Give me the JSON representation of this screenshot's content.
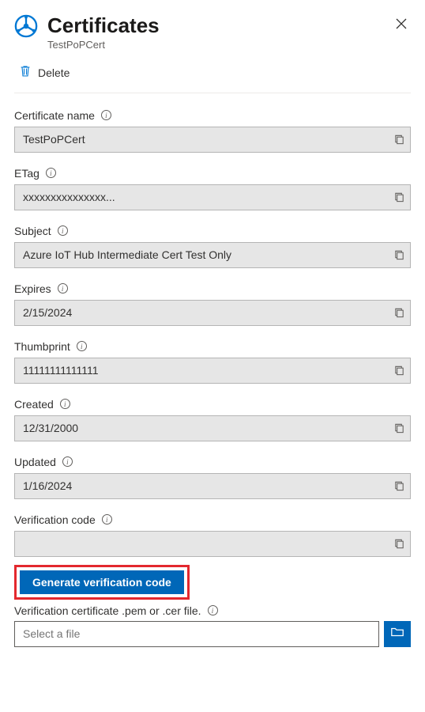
{
  "header": {
    "title": "Certificates",
    "subtitle": "TestPoPCert"
  },
  "toolbar": {
    "delete_label": "Delete"
  },
  "fields": {
    "certificate_name": {
      "label": "Certificate name",
      "value": "TestPoPCert"
    },
    "etag": {
      "label": "ETag",
      "value": "xxxxxxxxxxxxxxx..."
    },
    "subject": {
      "label": "Subject",
      "value": "Azure IoT Hub Intermediate Cert Test Only"
    },
    "expires": {
      "label": "Expires",
      "value": "2/15/2024"
    },
    "thumbprint": {
      "label": "Thumbprint",
      "value": "11111111111111"
    },
    "created": {
      "label": "Created",
      "value": "12/31/2000"
    },
    "updated": {
      "label": "Updated",
      "value": "1/16/2024"
    },
    "verification_code": {
      "label": "Verification code",
      "value": ""
    }
  },
  "actions": {
    "generate_label": "Generate verification code"
  },
  "file": {
    "label": "Verification certificate .pem or .cer file.",
    "placeholder": "Select a file"
  }
}
